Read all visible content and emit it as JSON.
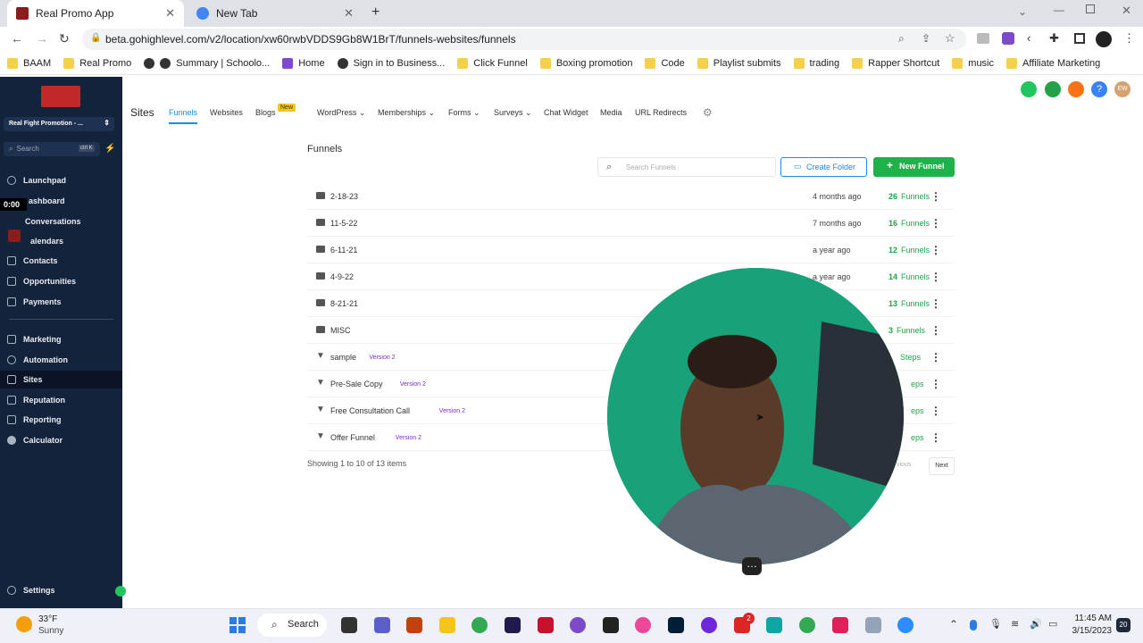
{
  "browser": {
    "tabs": [
      {
        "title": "Real Promo App"
      },
      {
        "title": "New Tab"
      }
    ],
    "url": "beta.gohighlevel.com/v2/location/xw60rwbVDDS9Gb8W1BrT/funnels-websites/funnels",
    "bookmarks": [
      "BAAM",
      "Real Promo",
      "Summary | Schoolo...",
      "Home",
      "Sign in to Business...",
      "Click Funnel",
      "Boxing promotion",
      "Code",
      "Playlist submits",
      "trading",
      "Rapper Shortcut",
      "music",
      "Affiliate Marketing"
    ]
  },
  "sidebar": {
    "account": "Real Fight Promotion - ...",
    "search_placeholder": "Search",
    "search_shortcut": "ctrl K",
    "timer": "0:00",
    "items": [
      {
        "label": "Launchpad"
      },
      {
        "label": "ashboard"
      },
      {
        "label": "Conversations"
      },
      {
        "label": "alendars"
      },
      {
        "label": "Contacts"
      },
      {
        "label": "Opportunities"
      },
      {
        "label": "Payments"
      },
      {
        "label": "Marketing"
      },
      {
        "label": "Automation"
      },
      {
        "label": "Sites"
      },
      {
        "label": "Reputation"
      },
      {
        "label": "Reporting"
      },
      {
        "label": "Calculator"
      }
    ],
    "settings": "Settings"
  },
  "topnav": {
    "section": "Sites",
    "items": [
      "Funnels",
      "Websites",
      "Blogs",
      "WordPress",
      "Memberships",
      "Forms",
      "Surveys",
      "Chat Widget",
      "Media",
      "URL Redirects"
    ],
    "blogs_badge": "New",
    "header_avatar": "EW"
  },
  "main": {
    "title": "Funnels",
    "search_placeholder": "Search Funnels",
    "create_folder": "Create Folder",
    "new_funnel": "New Funnel",
    "rows": [
      {
        "name": "2-18-23",
        "type": "folder",
        "when": "4 months ago",
        "count": "26",
        "unit": "Funnels"
      },
      {
        "name": "11-5-22",
        "type": "folder",
        "when": "7 months ago",
        "count": "16",
        "unit": "Funnels"
      },
      {
        "name": "6-11-21",
        "type": "folder",
        "when": "a year ago",
        "count": "12",
        "unit": "Funnels"
      },
      {
        "name": "4-9-22",
        "type": "folder",
        "when": "a year ago",
        "count": "14",
        "unit": "Funnels"
      },
      {
        "name": "8-21-21",
        "type": "folder",
        "when": "",
        "count": "13",
        "unit": "Funnels"
      },
      {
        "name": "MISC",
        "type": "folder",
        "when": "",
        "count": "3",
        "unit": "Funnels"
      },
      {
        "name": "sample",
        "type": "funnel",
        "version": "Version 2",
        "when": "",
        "count": "",
        "unit": "Steps"
      },
      {
        "name": "Pre-Sale Copy",
        "type": "funnel",
        "version": "Version 2",
        "when": "",
        "count": "",
        "unit": "eps"
      },
      {
        "name": "Free Consultation Call",
        "type": "funnel",
        "version": "Version 2",
        "when": "",
        "count": "",
        "unit": "eps"
      },
      {
        "name": "Offer Funnel",
        "type": "funnel",
        "version": "Version 2",
        "when": "",
        "count": "",
        "unit": "eps"
      }
    ],
    "showing": "Showing 1 to 10 of 13 items",
    "prev": "vious",
    "next": "Next"
  },
  "taskbar": {
    "weather_temp": "33°F",
    "weather_desc": "Sunny",
    "search": "Search",
    "time": "11:45 AM",
    "date": "3/15/2023",
    "notif_count": "20",
    "badge": "2"
  },
  "colors": {
    "accent_green": "#20b24a",
    "sidebar_bg": "#14233c",
    "link_blue": "#188bf6",
    "version_purple": "#7a2cc8"
  }
}
